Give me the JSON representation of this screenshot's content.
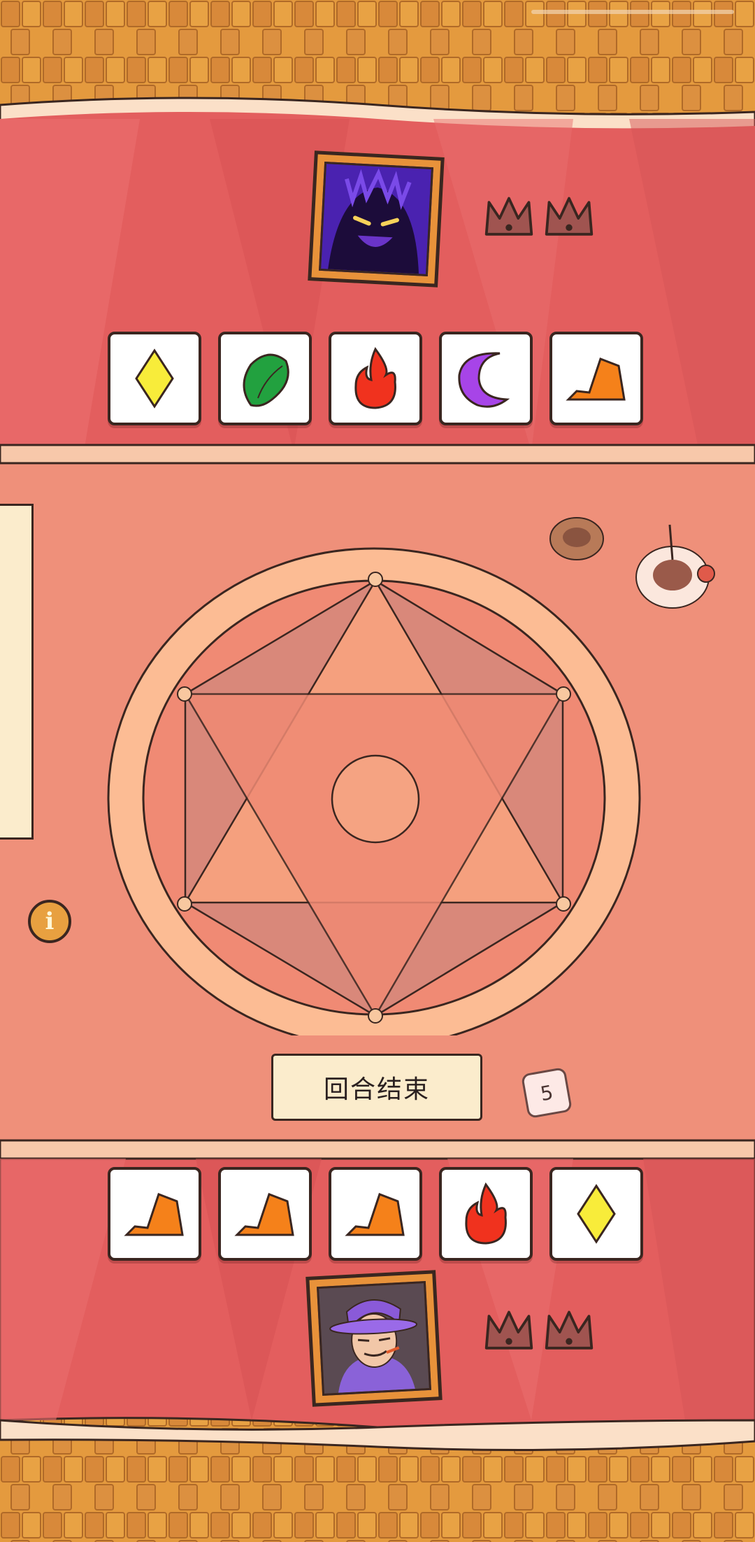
{
  "game": {
    "end_turn_label": "回合结束",
    "dice_value": "5",
    "info_symbol": "i"
  },
  "opponent": {
    "portrait": "shadow-demon-portrait",
    "crowns": [
      "crown-icon",
      "crown-icon"
    ],
    "cards": [
      "diamond-yellow-icon",
      "leaf-green-icon",
      "flame-red-icon",
      "moon-purple-icon",
      "rock-orange-icon"
    ]
  },
  "player": {
    "portrait": "wizard-portrait",
    "crowns": [
      "crown-icon",
      "crown-icon"
    ],
    "cards": [
      "rock-orange-icon",
      "rock-orange-icon",
      "rock-orange-icon",
      "flame-red-icon",
      "diamond-yellow-icon"
    ]
  },
  "colors": {
    "yellow": "#f8ec3a",
    "green": "#22a13f",
    "red": "#f0321e",
    "purple": "#a744e8",
    "orange": "#f5811a",
    "table": "#ef907a",
    "banner": "#e35e5e"
  }
}
